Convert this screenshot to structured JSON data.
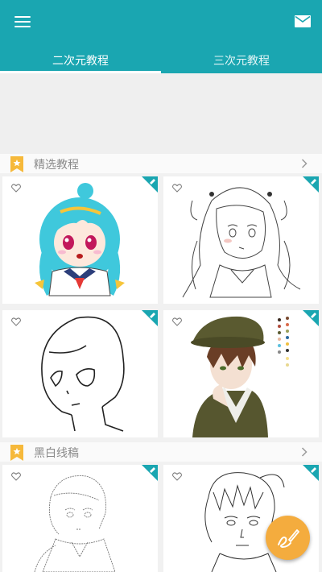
{
  "tabs": [
    {
      "label": "二次元教程",
      "active": true
    },
    {
      "label": "三次元教程",
      "active": false
    }
  ],
  "sections": [
    {
      "title": "精选教程"
    },
    {
      "title": "黑白线稿"
    }
  ],
  "colors": {
    "brand": "#1aa6b1",
    "bookmark": "#f6b93b",
    "fab": "#f4ac3e"
  },
  "icons": {
    "menu": "hamburger-menu-icon",
    "mail": "envelope-icon",
    "section": "bookmark-star-icon",
    "more": "chevron-right-icon",
    "favorite": "heart-outline-icon",
    "corner": "pencil-corner-icon",
    "fab": "pen-draw-icon"
  }
}
